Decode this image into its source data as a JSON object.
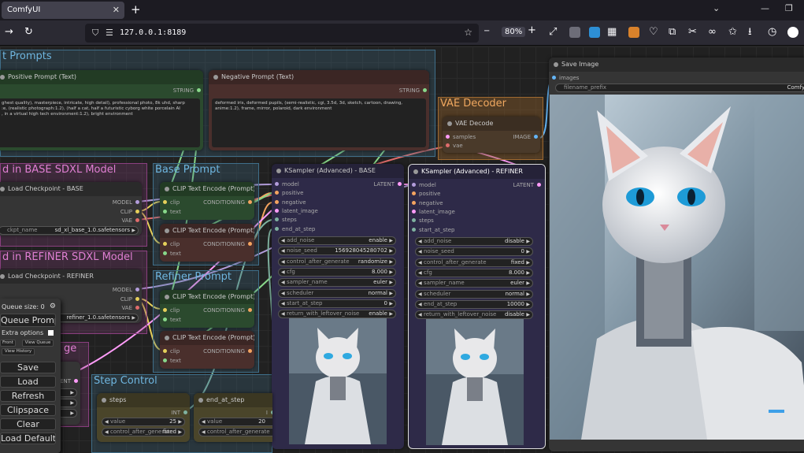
{
  "browser": {
    "tab_title": "ComfyUI",
    "tab_close": "✕",
    "new_tab": "+",
    "url": "127.0.0.1:8189",
    "zoom": "80%",
    "zoom_out": "−",
    "zoom_in": "+"
  },
  "groups": {
    "prompts": "t Prompts",
    "base_model": "d in BASE SDXL Model",
    "refiner_model": "d in REFINER SDXL Model",
    "base_prompt": "Base Prompt",
    "refiner_prompt": "Refiner Prompt",
    "vae_decoder": "VAE Decoder",
    "image": "ge",
    "step_control": "Step Control"
  },
  "nodes": {
    "positive_prompt": {
      "title": "Positive Prompt (Text)",
      "output": "STRING",
      "text": "ghest quality), masterpiece, intricate, high detail), professional photo, 8k uhd, sharp\n:e, (realistic photograph:1.2), (half a cat, half a futuristic cyborg white porcelain AI\n, in a virtual high tech environment:1.2), bright environment"
    },
    "negative_prompt": {
      "title": "Negative Prompt (Text)",
      "output": "STRING",
      "text": "deformed iris, deformed pupils, (semi-realistic, cgi, 3.5d, 3d, sketch, cartoon, drawing,\nanime:1.2), frame, mirror, polaroid, dark environment"
    },
    "load_base": {
      "title": "Load Checkpoint - BASE",
      "out_model": "MODEL",
      "out_clip": "CLIP",
      "out_vae": "VAE",
      "ckpt_label": "ckpt_name",
      "ckpt_value": "sd_xl_base_1.0.safetensors"
    },
    "load_refiner": {
      "title": "Load Checkpoint - REFINER",
      "out_model": "MODEL",
      "out_clip": "CLIP",
      "out_vae": "VAE",
      "ckpt_value": "refiner_1.0.safetensors"
    },
    "clip_base_pos": {
      "title": "CLIP Text Encode (Prompt)",
      "in_clip": "clip",
      "in_text": "text",
      "out": "CONDITIONING"
    },
    "clip_base_neg": {
      "title": "CLIP Text Encode (Prompt)",
      "in_clip": "clip",
      "in_text": "text",
      "out": "CONDITIONING"
    },
    "clip_ref_pos": {
      "title": "CLIP Text Encode (Prompt)",
      "in_clip": "clip",
      "in_text": "text",
      "out": "CONDITIONING"
    },
    "clip_ref_neg": {
      "title": "CLIP Text Encode (Prompt)",
      "in_clip": "clip",
      "in_text": "text",
      "out": "CONDITIONING"
    },
    "vae_decode": {
      "title": "VAE Decode",
      "in_samples": "samples",
      "in_vae": "vae",
      "out": "IMAGE"
    },
    "ksampler_base": {
      "title": "KSampler (Advanced) - BASE",
      "out": "LATENT",
      "inputs": [
        "model",
        "positive",
        "negative",
        "latent_image",
        "steps",
        "end_at_step"
      ],
      "widgets": [
        {
          "label": "add_noise",
          "value": "enable"
        },
        {
          "label": "noise_seed",
          "value": "156928045280702"
        },
        {
          "label": "control_after_generate",
          "value": "randomize"
        },
        {
          "label": "cfg",
          "value": "8.000"
        },
        {
          "label": "sampler_name",
          "value": "euler"
        },
        {
          "label": "scheduler",
          "value": "normal"
        },
        {
          "label": "start_at_step",
          "value": "0"
        },
        {
          "label": "return_with_leftover_noise",
          "value": "enable"
        }
      ]
    },
    "ksampler_refiner": {
      "title": "KSampler (Advanced) - REFINER",
      "out": "LATENT",
      "inputs": [
        "model",
        "positive",
        "negative",
        "latent_image",
        "steps",
        "start_at_step"
      ],
      "widgets": [
        {
          "label": "add_noise",
          "value": "disable"
        },
        {
          "label": "noise_seed",
          "value": "0"
        },
        {
          "label": "control_after_generate",
          "value": "fixed"
        },
        {
          "label": "cfg",
          "value": "8.000"
        },
        {
          "label": "sampler_name",
          "value": "euler"
        },
        {
          "label": "scheduler",
          "value": "normal"
        },
        {
          "label": "end_at_step",
          "value": "10000"
        },
        {
          "label": "return_with_leftover_noise",
          "value": "disable"
        }
      ]
    },
    "save_image": {
      "title": "Save Image",
      "in_images": "images",
      "prefix_label": "filename_prefix",
      "prefix_value": "Comfy"
    },
    "steps": {
      "title": "steps",
      "out": "INT",
      "value_label": "value",
      "value": "25",
      "cag_label": "control_after_generate",
      "cag_value": "fixed"
    },
    "end_at_step": {
      "title": "end_at_step",
      "out": "I",
      "value_label": "value",
      "value": "20",
      "cag_label": "control_after_generate",
      "cag_value": "fixed"
    },
    "partial_latent": {
      "out": "LATENT"
    }
  },
  "menu": {
    "queue_size": "Queue size: 0",
    "queue_prompt": "Queue Prompt",
    "extra_options": "Extra options",
    "front": "Front",
    "view_queue": "View Queue",
    "view_history": "View History",
    "save": "Save",
    "load": "Load",
    "refresh": "Refresh",
    "clipspace": "Clipspace",
    "clear": "Clear",
    "load_default": "Load Default"
  },
  "colors": {
    "accent_green": "#2b4a2e",
    "accent_brown": "#4a2f2c",
    "accent_purple": "#3a2a4e",
    "group_blue": "#3f6f8a",
    "group_pink": "#8a3f7f"
  }
}
